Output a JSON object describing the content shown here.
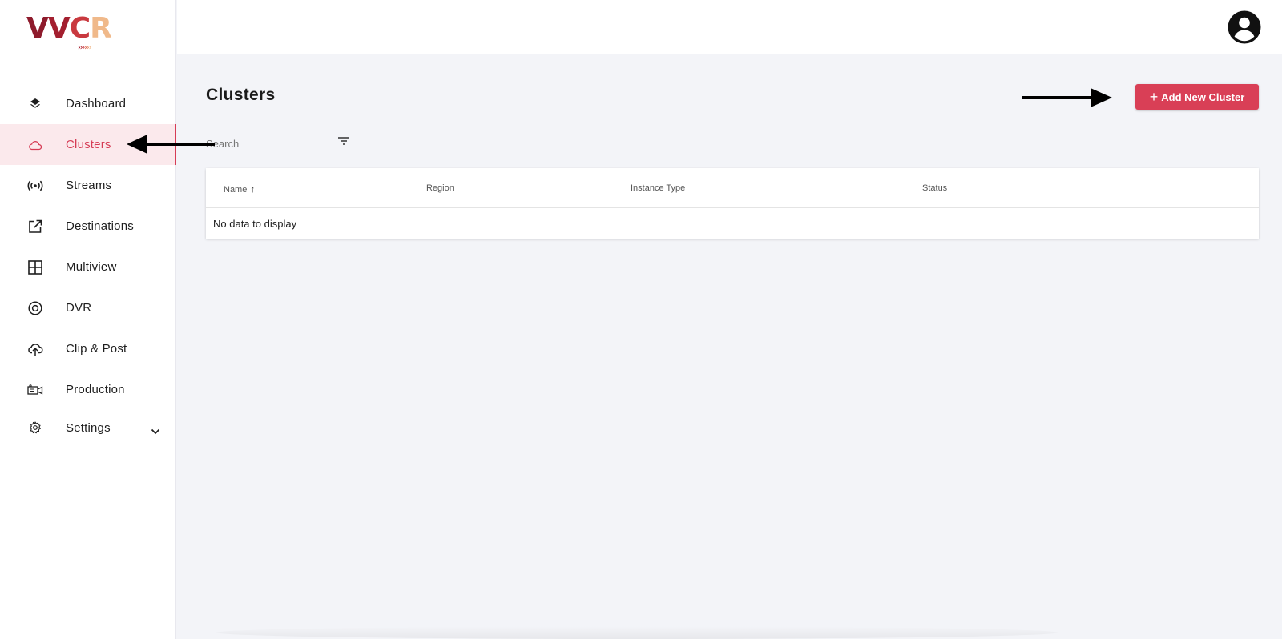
{
  "logo": {
    "text": "VVCR",
    "chevrons": "››››››"
  },
  "sidebar": {
    "items": [
      {
        "label": "Dashboard",
        "icon": "layers-icon"
      },
      {
        "label": "Clusters",
        "icon": "cloud-icon",
        "active": true
      },
      {
        "label": "Streams",
        "icon": "broadcast-icon"
      },
      {
        "label": "Destinations",
        "icon": "external-link-icon"
      },
      {
        "label": "Multiview",
        "icon": "grid-icon"
      },
      {
        "label": "DVR",
        "icon": "record-icon"
      },
      {
        "label": "Clip & Post",
        "icon": "cloud-upload-icon"
      },
      {
        "label": "Production",
        "icon": "video-camera-icon"
      },
      {
        "label": "Settings",
        "icon": "gear-icon",
        "expandable": true
      }
    ]
  },
  "header": {
    "avatar_icon": "account-circle-icon"
  },
  "main": {
    "title": "Clusters",
    "add_button_label": "Add New Cluster",
    "search_placeholder": "Search",
    "table": {
      "columns": [
        "Name",
        "Region",
        "Instance Type",
        "Status"
      ],
      "sort_column": "Name",
      "sort_direction": "asc",
      "empty_message": "No data to display"
    }
  },
  "colors": {
    "accent": "#d93f56",
    "active_bg": "#fbe9ec",
    "page_bg": "#f3f4f8"
  }
}
